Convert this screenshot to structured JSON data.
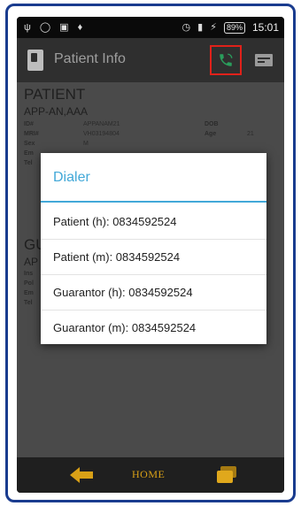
{
  "status_bar": {
    "battery": "89%",
    "time": "15:01",
    "icons": [
      "usb-icon",
      "location-icon",
      "image-icon",
      "notification-icon",
      "alarm-icon",
      "signal-icon",
      "charging-icon"
    ]
  },
  "app_bar": {
    "title": "Patient Info",
    "icons": [
      "app-logo-icon",
      "phone-call-icon",
      "id-card-icon"
    ],
    "highlight_color": "#e0211a"
  },
  "patient": {
    "section_title": "PATIENT",
    "name": "APP-AN,AAA",
    "fields": [
      {
        "label": "ID#",
        "value": "APPANAM21"
      },
      {
        "label": "MRI#",
        "value": "VH03194804"
      },
      {
        "label": "Sex",
        "value": "M"
      },
      {
        "label": "Em",
        "value": ""
      },
      {
        "label": "Tel",
        "value": ""
      }
    ],
    "right_fields": [
      {
        "label": "DOB",
        "value": ""
      },
      {
        "label": "Age",
        "value": "21"
      }
    ]
  },
  "guarantor": {
    "section_title": "GU",
    "name": "AP",
    "fields": [
      {
        "label": "Ins"
      },
      {
        "label": "Pol"
      },
      {
        "label": "Em"
      },
      {
        "label": "Tel"
      }
    ]
  },
  "dialog": {
    "title": "Dialer",
    "accent_color": "#42a8d8",
    "items": [
      "Patient (h): 0834592524",
      "Patient (m): 0834592524",
      "Guarantor (h): 0834592524",
      "Guarantor (m): 0834592524"
    ]
  },
  "nav_bar": {
    "home_label": "HOME",
    "icons": [
      "back-arrow-icon",
      "recent-apps-icon"
    ],
    "accent_color": "#d8a017"
  }
}
